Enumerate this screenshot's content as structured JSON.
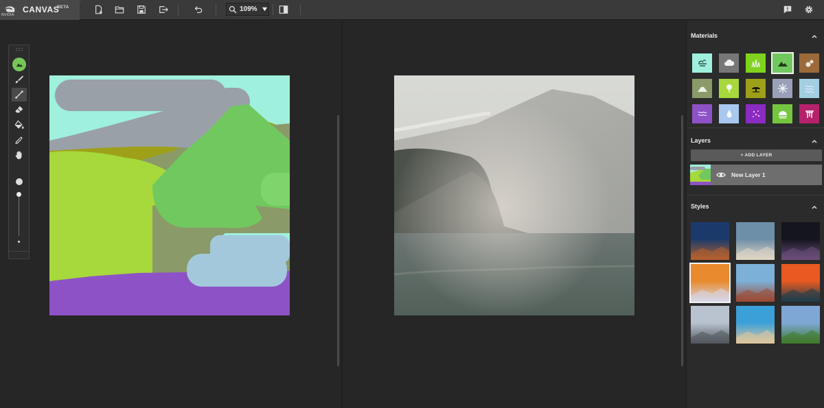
{
  "app": {
    "brand_logo_text": "NVIDIA",
    "name": "CANVAS",
    "badge": "BETA"
  },
  "toolbar": {
    "new_icon": "new-file-icon",
    "open_icon": "folder-open-icon",
    "save_icon": "save-icon",
    "export_icon": "export-icon",
    "undo_icon": "undo-icon",
    "zoom_icon": "magnifier-icon",
    "zoom_value": "109%",
    "view_toggle_icon": "split-view-icon",
    "feedback_icon": "feedback-icon",
    "settings_icon": "gear-icon"
  },
  "tools": [
    {
      "name": "landscape-brush",
      "icon": "mountain-icon",
      "active": true
    },
    {
      "name": "brush",
      "icon": "brush-icon"
    },
    {
      "name": "line",
      "icon": "line-icon"
    },
    {
      "name": "eraser",
      "icon": "eraser-icon"
    },
    {
      "name": "fill",
      "icon": "paint-bucket-icon"
    },
    {
      "name": "eyedropper",
      "icon": "eyedropper-icon"
    },
    {
      "name": "pan",
      "icon": "hand-icon"
    }
  ],
  "brush_size_level": 0.9,
  "panel": {
    "materials": {
      "title": "Materials",
      "items": [
        {
          "id": "sky",
          "color": "#9ff0dc"
        },
        {
          "id": "cloud",
          "color": "#777777"
        },
        {
          "id": "grass",
          "color": "#7fd31e"
        },
        {
          "id": "hill",
          "color": "#71c85f",
          "selected": true
        },
        {
          "id": "rock",
          "color": "#9c6a3a"
        },
        {
          "id": "mountain",
          "color": "#8a9a68"
        },
        {
          "id": "tree",
          "color": "#a7d83c"
        },
        {
          "id": "bush",
          "color": "#9ea01a"
        },
        {
          "id": "snow",
          "color": "#9aa0b8"
        },
        {
          "id": "sea",
          "color": "#a3cfe0"
        },
        {
          "id": "river",
          "color": "#8e52c7"
        },
        {
          "id": "water",
          "color": "#a9c8f0"
        },
        {
          "id": "flower",
          "color": "#8a2bc2"
        },
        {
          "id": "fog",
          "color": "#74c63e"
        },
        {
          "id": "building",
          "color": "#b5226b"
        }
      ]
    },
    "layers": {
      "title": "Layers",
      "add_label": "+ ADD LAYER",
      "items": [
        {
          "name": "New Layer 1",
          "visible_icon": "eye-icon"
        }
      ]
    },
    "styles": {
      "title": "Styles",
      "items": [
        {
          "id": "style-1",
          "colors": [
            "#1b3a6b",
            "#b5602d"
          ]
        },
        {
          "id": "style-2",
          "colors": [
            "#6d8fa8",
            "#e0d6c4"
          ]
        },
        {
          "id": "style-3",
          "colors": [
            "#151520",
            "#6b4e7a"
          ]
        },
        {
          "id": "style-4",
          "colors": [
            "#e98a2e",
            "#d7d7e8"
          ],
          "selected": true
        },
        {
          "id": "style-5",
          "colors": [
            "#7db0d8",
            "#9b4a34"
          ]
        },
        {
          "id": "style-6",
          "colors": [
            "#e85a22",
            "#1f3d4a"
          ]
        },
        {
          "id": "style-7",
          "colors": [
            "#b8c3cf",
            "#52575d"
          ]
        },
        {
          "id": "style-8",
          "colors": [
            "#3ca0d8",
            "#e0c79e"
          ]
        },
        {
          "id": "style-9",
          "colors": [
            "#7fa7d6",
            "#3f7a2a"
          ]
        }
      ]
    }
  }
}
